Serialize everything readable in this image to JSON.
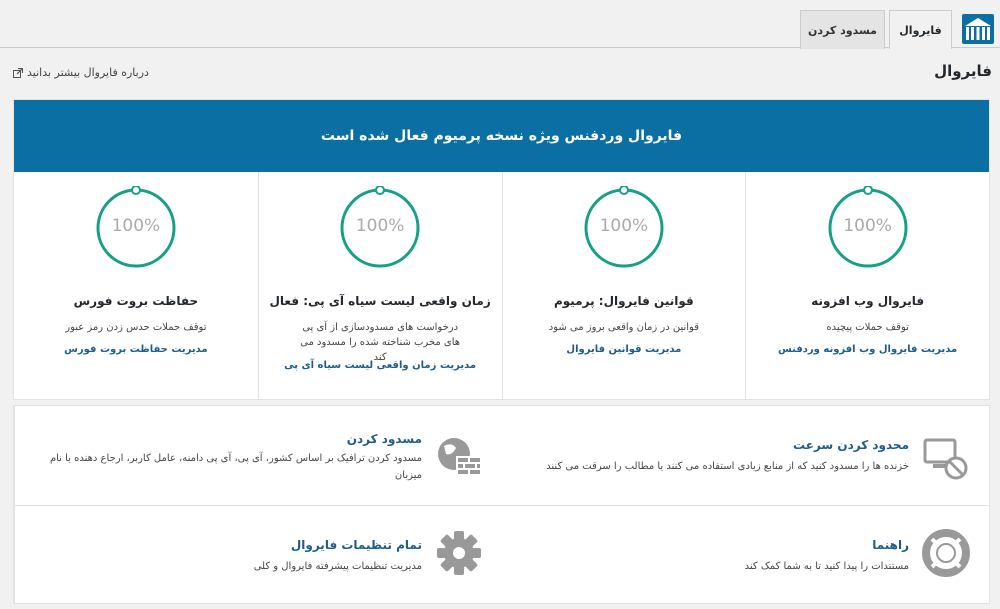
{
  "tabs": {
    "firewall": "فایروال",
    "blocking": "مسدود کردن"
  },
  "page": {
    "title": "فایروال",
    "learn_more": "درباره فایروال بیشتر بدانید"
  },
  "banner": "فایروال وردفنس ویژه نسخه پرمیوم فعال شده است",
  "features": [
    {
      "percent": "100%",
      "progress": 1.0,
      "title": "فایروال وب افزونه",
      "desc": "توقف حملات پیچیده",
      "link": "مدیریت فایروال وب افزونه وردفنس"
    },
    {
      "percent": "100%",
      "progress": 1.0,
      "title": "قوانین فایروال: پرمیوم",
      "desc": "قوانین در زمان واقعی بروز می شود",
      "link": "مدیریت قوانین فایروال"
    },
    {
      "percent": "100%",
      "progress": 1.0,
      "title": "زمان واقعی لیست سیاه آی پی: فعال",
      "desc": "درخواست های مسدودسازی از آی پی های مخرب شناخته شده را مسدود می کند",
      "link": "مدیریت زمان واقعی لیست سیاه آی پی"
    },
    {
      "percent": "100%",
      "progress": 1.0,
      "title": "حفاظت بروت فورس",
      "desc": "توقف حملات حدس زدن رمز عبور",
      "link": "مدیریت حفاظت بروت فورس"
    }
  ],
  "tools": {
    "rate_limiting": {
      "title": "محدود کردن سرعت",
      "desc": "خزنده ها را مسدود کنید که از منابع زیادی استفاده می کنند یا مطالب را سرقت می کنند"
    },
    "blocking": {
      "title": "مسدود کردن",
      "desc": "مسدود کردن ترافیک بر اساس کشور، آی پی، آی پی دامنه، عامل کاربر، ارجاع دهنده یا نام میزبان"
    },
    "help": {
      "title": "راهنما",
      "desc": "مستندات را پیدا کنید تا به شما کمک کند"
    },
    "all_settings": {
      "title": "تمام تنظیمات فایروال",
      "desc": "مدیریت تنظیمات پیشرفته فایروال و کلی"
    }
  },
  "colors": {
    "banner": "#0b6fa4",
    "ring": "#16a085",
    "link": "#1e5c8a"
  },
  "icons": [
    "wordfence-logo-icon",
    "external-link-icon",
    "rate-limit-icon",
    "globe-wall-icon",
    "lifebuoy-icon",
    "gear-icon"
  ]
}
